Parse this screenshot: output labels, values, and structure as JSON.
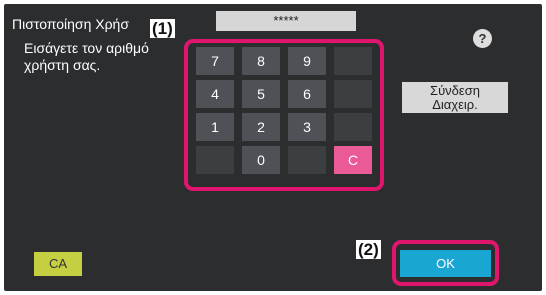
{
  "header": {
    "title": "Πιστοποίηση Χρήσ",
    "password_mask": "*****",
    "help_label": "?"
  },
  "instruction": "Εισάγετε τον αριθμό\nχρήστη σας.",
  "keypad": {
    "keys": [
      "7",
      "8",
      "9",
      "4",
      "5",
      "6",
      "1",
      "2",
      "3",
      "0"
    ],
    "clear_label": "C"
  },
  "buttons": {
    "admin_login": "Σύνδεση\nΔιαχειρ.",
    "clear_all": "CA",
    "ok": "OK"
  },
  "callouts": {
    "keypad": "(1)",
    "ok": "(2)"
  },
  "colors": {
    "highlight_frame": "#e0166e",
    "ok_button": "#19a6d2",
    "ca_button": "#c4cf42",
    "clear_key": "#ea5a97"
  }
}
